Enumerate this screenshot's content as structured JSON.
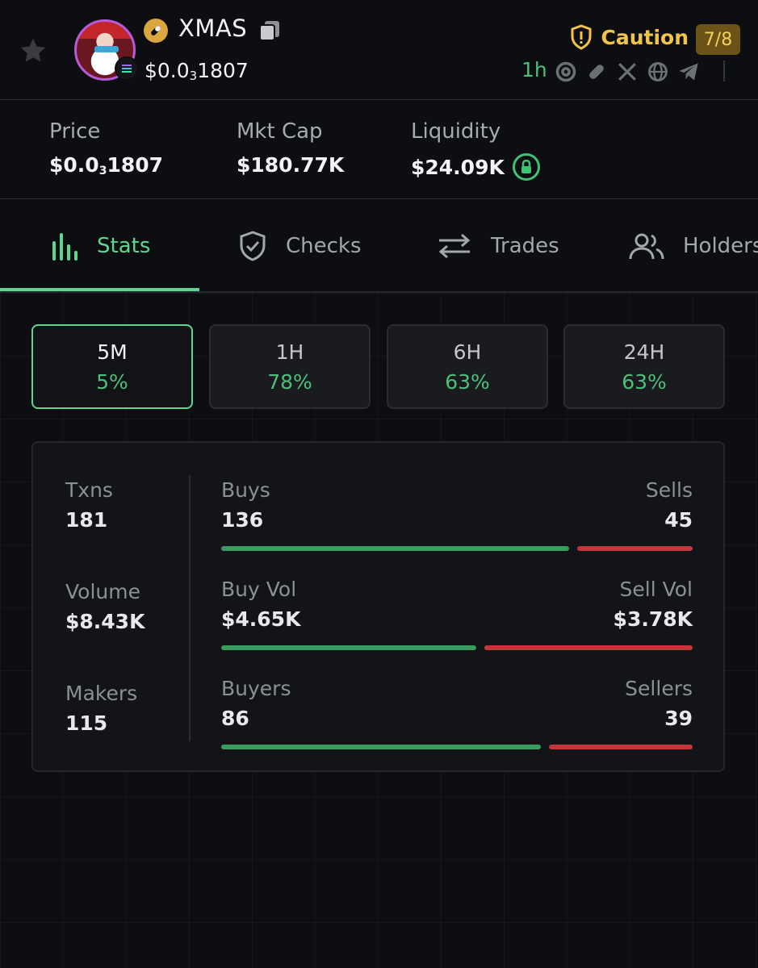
{
  "header": {
    "symbol": "XMAS",
    "price_prefix": "$0.0",
    "price_sub": "3",
    "price_rest": "1807",
    "caution_label": "Caution",
    "score": "7/8",
    "age": "1h",
    "accent_color": "#5fd690",
    "caution_color": "#f0c54a"
  },
  "metrics": {
    "price_label": "Price",
    "price_prefix": "$0.0",
    "price_sub": "3",
    "price_rest": "1807",
    "mcap_label": "Mkt Cap",
    "mcap_value": "$180.77K",
    "liq_label": "Liquidity",
    "liq_value": "$24.09K"
  },
  "tabs": {
    "stats": "Stats",
    "checks": "Checks",
    "trades": "Trades",
    "holders": "Holders"
  },
  "timeframes": [
    {
      "label": "5M",
      "pct": "5%"
    },
    {
      "label": "1H",
      "pct": "78%"
    },
    {
      "label": "6H",
      "pct": "63%"
    },
    {
      "label": "24H",
      "pct": "63%"
    }
  ],
  "stats": {
    "txns_label": "Txns",
    "txns_value": "181",
    "volume_label": "Volume",
    "volume_value": "$8.43K",
    "makers_label": "Makers",
    "makers_value": "115",
    "buys_label": "Buys",
    "buys_value": "136",
    "sells_label": "Sells",
    "sells_value": "45",
    "buyvol_label": "Buy Vol",
    "buyvol_value": "$4.65K",
    "sellvol_label": "Sell Vol",
    "sellvol_value": "$3.78K",
    "buyers_label": "Buyers",
    "buyers_value": "86",
    "sellers_label": "Sellers",
    "sellers_value": "39",
    "buy_share_txns": 0.75,
    "buy_share_vol": 0.55,
    "buy_share_makers": 0.69
  }
}
